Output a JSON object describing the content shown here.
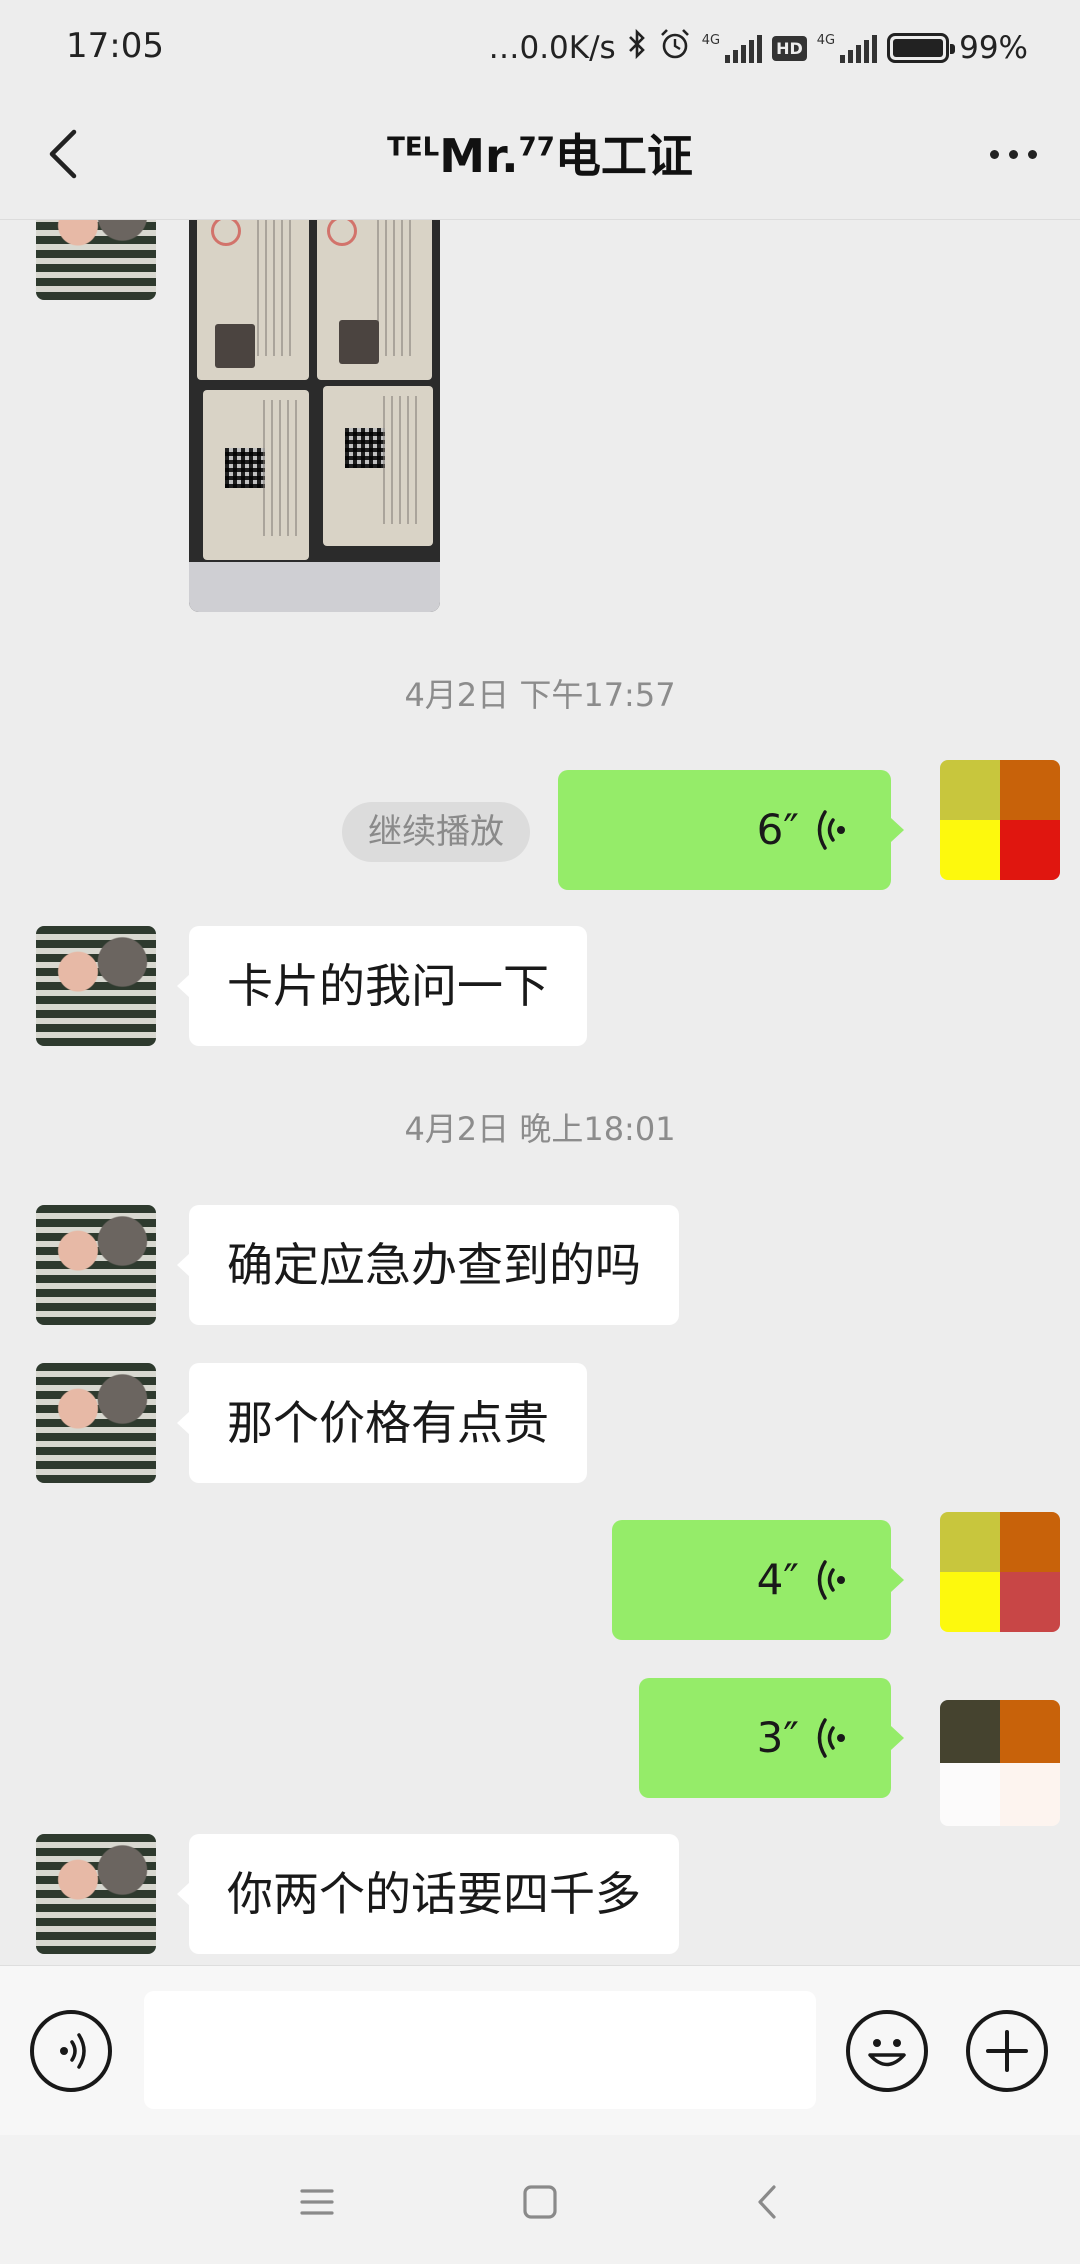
{
  "status_bar": {
    "time": "17:05",
    "net_speed": "…0.0K/s",
    "sim1_type": "4G",
    "hd_badge": "HD",
    "sim2_type": "4G",
    "battery_percent": 99,
    "battery_text": "99%"
  },
  "header": {
    "title_prefix": "TEL",
    "title_name": "Mr.",
    "title_sup": "77",
    "title_suffix": "电工证"
  },
  "messages": {
    "time_1": "4月2日 下午17:57",
    "voice_1_duration": "6″",
    "resume_label": "继续播放",
    "text_1": "卡片的我问一下",
    "time_2": "4月2日 晚上18:01",
    "text_2": "确定应急办查到的吗",
    "text_3": "那个价格有点贵",
    "voice_2_duration": "4″",
    "voice_3_duration": "3″",
    "text_4": "你两个的话要四千多"
  },
  "colors": {
    "chat_bg": "#ededed",
    "outgoing_bubble": "#95ec69",
    "incoming_bubble": "#ffffff",
    "timestamp_text": "#8c8c8c",
    "my_avatar_1": [
      "#c8c63d",
      "#c8620a",
      "#fdf90d",
      "#e0160f"
    ],
    "my_avatar_2": [
      "#c8c63d",
      "#c8620a",
      "#fdf90d",
      "#c84646"
    ],
    "my_avatar_3": [
      "#45432f",
      "#c8620a",
      "#fcfbfb",
      "#fdf4ef"
    ]
  },
  "icons": {
    "back": "chevron-left-icon",
    "more": "more-dots-icon",
    "voice_input": "voice-mode-icon",
    "emoji": "emoji-icon",
    "plus": "plus-icon"
  }
}
